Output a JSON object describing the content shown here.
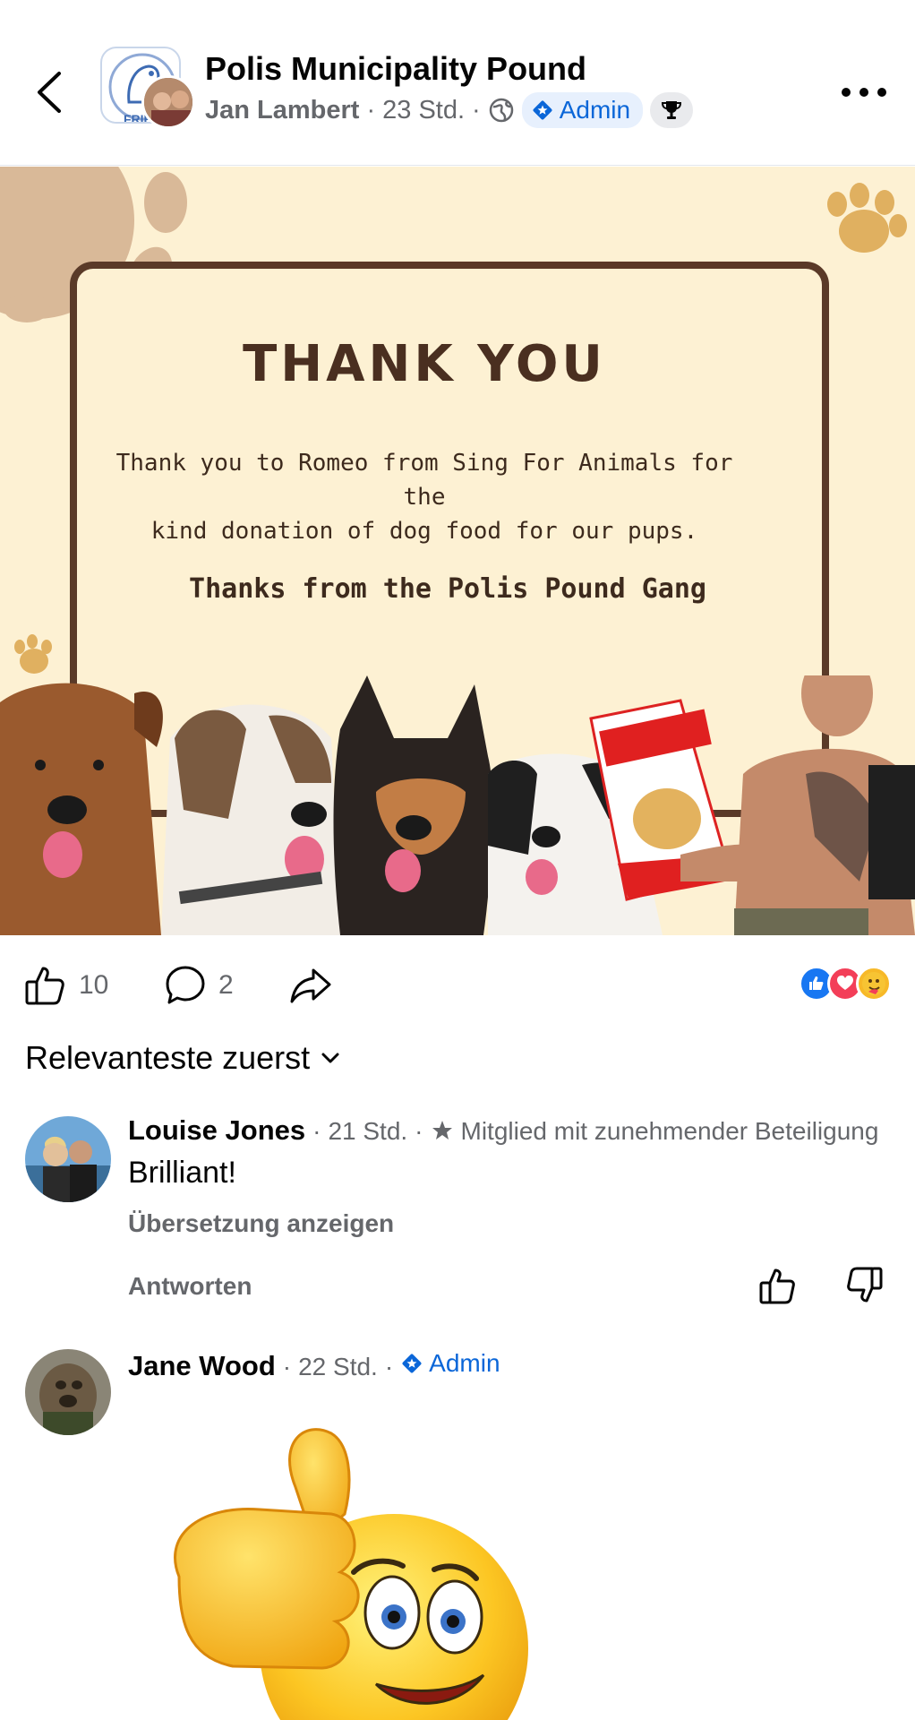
{
  "header": {
    "group_name": "Polis Municipality Pound",
    "author": "Jan Lambert",
    "time": "23 Std.",
    "sep": "·",
    "badge_admin": "Admin"
  },
  "post": {
    "image": {
      "title": "THANK YOU",
      "body_line1": "Thank you to Romeo from Sing For Animals for the",
      "body_line2": "kind donation of dog food for our pups.",
      "signature": "Thanks from the Polis Pound Gang",
      "group_logo_text": "FRIEN"
    },
    "likes": "10",
    "comments": "2",
    "reactions": [
      "like-icon",
      "love-icon",
      "care-icon"
    ]
  },
  "sort_label": "Relevanteste zuerst",
  "comments": [
    {
      "author": "Louise Jones",
      "time": "21 Std.",
      "badge": "Mitglied mit zunehmender Beteiligung",
      "text": "Brilliant!",
      "translate": "Übersetzung anzeigen",
      "reply": "Antworten"
    },
    {
      "author": "Jane Wood",
      "time": "22 Std.",
      "badge": "Admin"
    }
  ],
  "colors": {
    "accent": "#0a66d8",
    "card_border": "#5a3a28",
    "card_bg": "#fdf1d3"
  }
}
